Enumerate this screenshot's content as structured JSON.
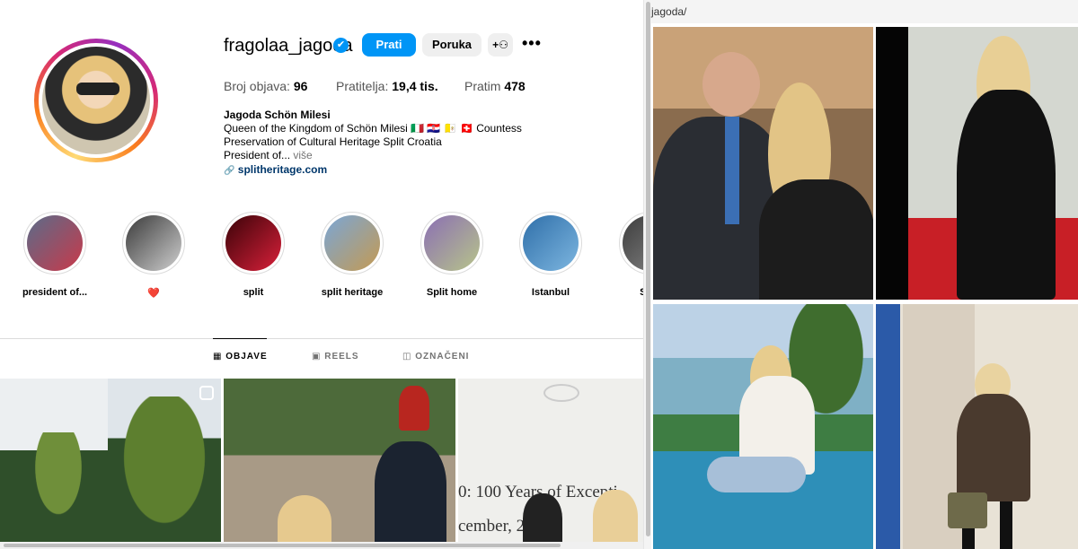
{
  "profile": {
    "username": "fragolaa_jagoda",
    "verified_mark": "✔",
    "buttons": {
      "follow": "Prati",
      "message": "Poruka",
      "add_user_icon": "+⚇",
      "more": "•••"
    },
    "stats": {
      "posts_label": "Broj objava:",
      "posts_value": "96",
      "followers_label": "Pratitelja:",
      "followers_value": "19,4 tis.",
      "following_label": "Pratim",
      "following_value": "478"
    },
    "bio": {
      "name": "Jagoda Schön Milesi",
      "line1": "Queen of the Kingdom of Schön Milesi 🇮🇹 🇭🇷 🇻🇦 🇨🇭 Countess",
      "line2": "Preservation of Cultural Heritage Split Croatia",
      "line3": "President of...",
      "more": " više",
      "link_icon": "🔗",
      "link": "splitheritage.com"
    }
  },
  "highlights": [
    {
      "label": "president of...",
      "colors": [
        "#5a6c8a",
        "#c9394a"
      ]
    },
    {
      "label": "❤️",
      "colors": [
        "#3a3a3a",
        "#cfcfcf"
      ]
    },
    {
      "label": "split",
      "colors": [
        "#3a0308",
        "#d9203a"
      ]
    },
    {
      "label": "split heritage",
      "colors": [
        "#7aa6d6",
        "#c49a52"
      ]
    },
    {
      "label": "Split home",
      "colors": [
        "#8b6fb3",
        "#b7c48a"
      ]
    },
    {
      "label": "Istanbul",
      "colors": [
        "#2f6fa9",
        "#7db6e0"
      ]
    },
    {
      "label": "Split",
      "colors": [
        "#3c3c3c",
        "#8a8a8a"
      ]
    }
  ],
  "tabs": [
    {
      "icon": "▦",
      "label": "OBJAVE"
    },
    {
      "icon": "▣",
      "label": "REELS"
    },
    {
      "icon": "◫",
      "label": "OZNAČENI"
    }
  ],
  "post3_caption": {
    "line1": "0: 100 Years of Excepti",
    "line2": "cember, 2"
  },
  "right_pane": {
    "url_fragment": "jagoda/"
  },
  "accent_colors": {
    "primary": "#0095f6",
    "link": "#00376b"
  }
}
